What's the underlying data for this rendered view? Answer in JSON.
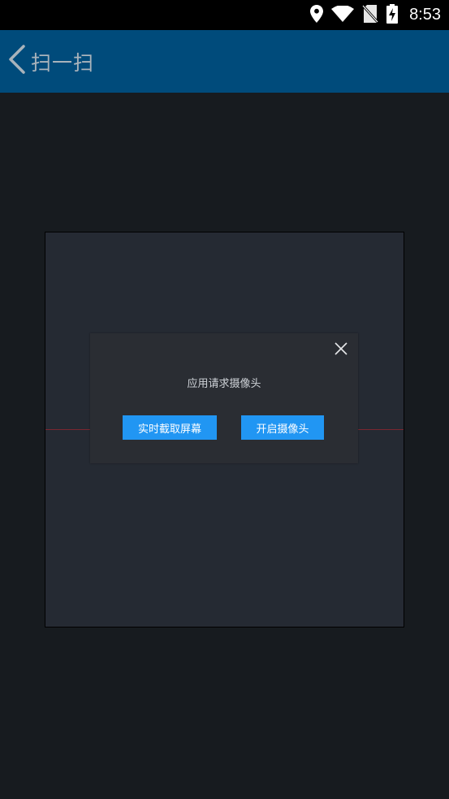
{
  "status_bar": {
    "time": "8:53",
    "icons": [
      "location-icon",
      "wifi-icon",
      "no-sim-icon",
      "battery-charging-icon"
    ]
  },
  "app_bar": {
    "title": "扫一扫",
    "back_icon": "chevron-left-icon"
  },
  "dialog": {
    "message": "应用请求摄像头",
    "capture_button_label": "实时截取屏幕",
    "camera_button_label": "开启摄像头",
    "close_icon": "close-icon"
  },
  "colors": {
    "app_bar": "#004b7b",
    "background": "#171b1f",
    "scan_frame": "#252a33",
    "dialog": "#2a2d33",
    "button": "#2196f3",
    "scan_line": "#7a2630"
  }
}
